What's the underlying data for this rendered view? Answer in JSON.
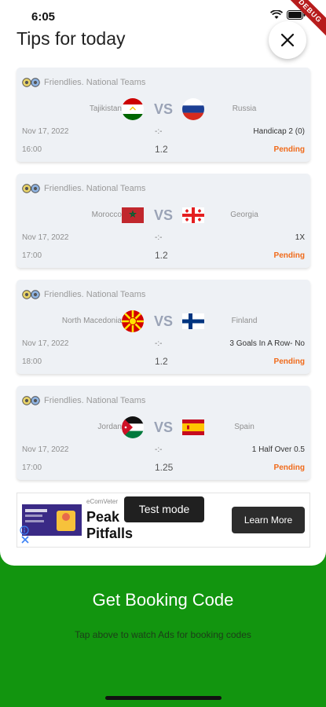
{
  "status_bar": {
    "time": "6:05",
    "ribbon": "DEBUG"
  },
  "header": {
    "title": "Tips for today"
  },
  "tips": [
    {
      "league": "Friendlies. National Teams",
      "home": "Tajikistan",
      "away": "Russia",
      "date": "Nov 17, 2022",
      "time": "16:00",
      "score": "-:-",
      "prediction": "Handicap 2 (0)",
      "odds": "1.2",
      "status": "Pending"
    },
    {
      "league": "Friendlies. National Teams",
      "home": "Morocco",
      "away": "Georgia",
      "date": "Nov 17, 2022",
      "time": "17:00",
      "score": "-:-",
      "prediction": "1X",
      "odds": "1.2",
      "status": "Pending"
    },
    {
      "league": "Friendlies. National Teams",
      "home": "North Macedonia",
      "away": "Finland",
      "date": "Nov 17, 2022",
      "time": "18:00",
      "score": "-:-",
      "prediction": "3 Goals In A Row- No",
      "odds": "1.2",
      "status": "Pending"
    },
    {
      "league": "Friendlies. National Teams",
      "home": "Jordan",
      "away": "Spain",
      "date": "Nov 17, 2022",
      "time": "17:00",
      "score": "-:-",
      "prediction": "1 Half Over 0.5",
      "odds": "1.25",
      "status": "Pending"
    }
  ],
  "vs_label": "VS",
  "ad": {
    "source": "eComVeter",
    "headline": "Peak Pitfalls",
    "test_mode": "Test mode",
    "cta": "Learn More"
  },
  "footer": {
    "title": "Get Booking Code",
    "hint": "Tap above to watch Ads for booking codes"
  },
  "colors": {
    "accent_green": "#12950f",
    "pending": "#f06a1a",
    "card_bg": "#eef1f5"
  }
}
